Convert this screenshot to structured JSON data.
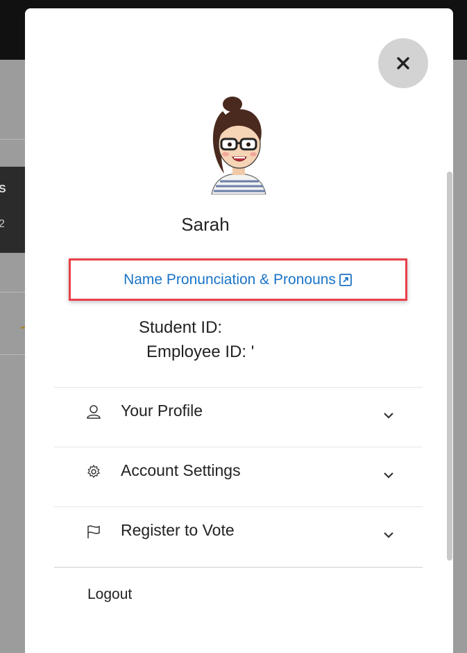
{
  "background": {
    "strip_letter_1": "S",
    "strip_letter_2": "2"
  },
  "profile": {
    "name": "Sarah",
    "pronunciation_link": "Name Pronunciation & Pronouns",
    "student_id_label": "Student ID:",
    "employee_id_label": "Employee ID:",
    "employee_id_value": "'"
  },
  "menu": {
    "items": [
      {
        "label": "Your Profile",
        "icon": "person-icon"
      },
      {
        "label": "Account Settings",
        "icon": "gear-icon"
      },
      {
        "label": "Register to Vote",
        "icon": "flag-icon"
      }
    ],
    "logout": "Logout"
  },
  "colors": {
    "link": "#1a73c7",
    "highlight": "#e8404a",
    "close_bg": "#d3d3d3"
  }
}
